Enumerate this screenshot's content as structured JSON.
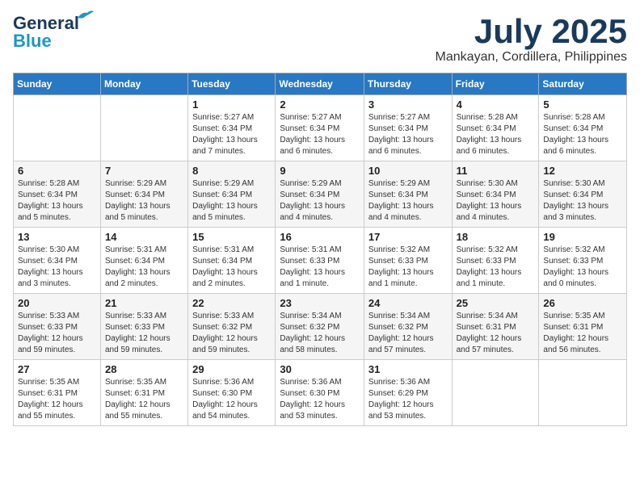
{
  "logo": {
    "part1": "General",
    "part2": "Blue"
  },
  "title": "July 2025",
  "location": "Mankayan, Cordillera, Philippines",
  "weekdays": [
    "Sunday",
    "Monday",
    "Tuesday",
    "Wednesday",
    "Thursday",
    "Friday",
    "Saturday"
  ],
  "weeks": [
    [
      {
        "day": "",
        "info": ""
      },
      {
        "day": "",
        "info": ""
      },
      {
        "day": "1",
        "info": "Sunrise: 5:27 AM\nSunset: 6:34 PM\nDaylight: 13 hours and 7 minutes."
      },
      {
        "day": "2",
        "info": "Sunrise: 5:27 AM\nSunset: 6:34 PM\nDaylight: 13 hours and 6 minutes."
      },
      {
        "day": "3",
        "info": "Sunrise: 5:27 AM\nSunset: 6:34 PM\nDaylight: 13 hours and 6 minutes."
      },
      {
        "day": "4",
        "info": "Sunrise: 5:28 AM\nSunset: 6:34 PM\nDaylight: 13 hours and 6 minutes."
      },
      {
        "day": "5",
        "info": "Sunrise: 5:28 AM\nSunset: 6:34 PM\nDaylight: 13 hours and 6 minutes."
      }
    ],
    [
      {
        "day": "6",
        "info": "Sunrise: 5:28 AM\nSunset: 6:34 PM\nDaylight: 13 hours and 5 minutes."
      },
      {
        "day": "7",
        "info": "Sunrise: 5:29 AM\nSunset: 6:34 PM\nDaylight: 13 hours and 5 minutes."
      },
      {
        "day": "8",
        "info": "Sunrise: 5:29 AM\nSunset: 6:34 PM\nDaylight: 13 hours and 5 minutes."
      },
      {
        "day": "9",
        "info": "Sunrise: 5:29 AM\nSunset: 6:34 PM\nDaylight: 13 hours and 4 minutes."
      },
      {
        "day": "10",
        "info": "Sunrise: 5:29 AM\nSunset: 6:34 PM\nDaylight: 13 hours and 4 minutes."
      },
      {
        "day": "11",
        "info": "Sunrise: 5:30 AM\nSunset: 6:34 PM\nDaylight: 13 hours and 4 minutes."
      },
      {
        "day": "12",
        "info": "Sunrise: 5:30 AM\nSunset: 6:34 PM\nDaylight: 13 hours and 3 minutes."
      }
    ],
    [
      {
        "day": "13",
        "info": "Sunrise: 5:30 AM\nSunset: 6:34 PM\nDaylight: 13 hours and 3 minutes."
      },
      {
        "day": "14",
        "info": "Sunrise: 5:31 AM\nSunset: 6:34 PM\nDaylight: 13 hours and 2 minutes."
      },
      {
        "day": "15",
        "info": "Sunrise: 5:31 AM\nSunset: 6:34 PM\nDaylight: 13 hours and 2 minutes."
      },
      {
        "day": "16",
        "info": "Sunrise: 5:31 AM\nSunset: 6:33 PM\nDaylight: 13 hours and 1 minute."
      },
      {
        "day": "17",
        "info": "Sunrise: 5:32 AM\nSunset: 6:33 PM\nDaylight: 13 hours and 1 minute."
      },
      {
        "day": "18",
        "info": "Sunrise: 5:32 AM\nSunset: 6:33 PM\nDaylight: 13 hours and 1 minute."
      },
      {
        "day": "19",
        "info": "Sunrise: 5:32 AM\nSunset: 6:33 PM\nDaylight: 13 hours and 0 minutes."
      }
    ],
    [
      {
        "day": "20",
        "info": "Sunrise: 5:33 AM\nSunset: 6:33 PM\nDaylight: 12 hours and 59 minutes."
      },
      {
        "day": "21",
        "info": "Sunrise: 5:33 AM\nSunset: 6:33 PM\nDaylight: 12 hours and 59 minutes."
      },
      {
        "day": "22",
        "info": "Sunrise: 5:33 AM\nSunset: 6:32 PM\nDaylight: 12 hours and 59 minutes."
      },
      {
        "day": "23",
        "info": "Sunrise: 5:34 AM\nSunset: 6:32 PM\nDaylight: 12 hours and 58 minutes."
      },
      {
        "day": "24",
        "info": "Sunrise: 5:34 AM\nSunset: 6:32 PM\nDaylight: 12 hours and 57 minutes."
      },
      {
        "day": "25",
        "info": "Sunrise: 5:34 AM\nSunset: 6:31 PM\nDaylight: 12 hours and 57 minutes."
      },
      {
        "day": "26",
        "info": "Sunrise: 5:35 AM\nSunset: 6:31 PM\nDaylight: 12 hours and 56 minutes."
      }
    ],
    [
      {
        "day": "27",
        "info": "Sunrise: 5:35 AM\nSunset: 6:31 PM\nDaylight: 12 hours and 55 minutes."
      },
      {
        "day": "28",
        "info": "Sunrise: 5:35 AM\nSunset: 6:31 PM\nDaylight: 12 hours and 55 minutes."
      },
      {
        "day": "29",
        "info": "Sunrise: 5:36 AM\nSunset: 6:30 PM\nDaylight: 12 hours and 54 minutes."
      },
      {
        "day": "30",
        "info": "Sunrise: 5:36 AM\nSunset: 6:30 PM\nDaylight: 12 hours and 53 minutes."
      },
      {
        "day": "31",
        "info": "Sunrise: 5:36 AM\nSunset: 6:29 PM\nDaylight: 12 hours and 53 minutes."
      },
      {
        "day": "",
        "info": ""
      },
      {
        "day": "",
        "info": ""
      }
    ]
  ]
}
